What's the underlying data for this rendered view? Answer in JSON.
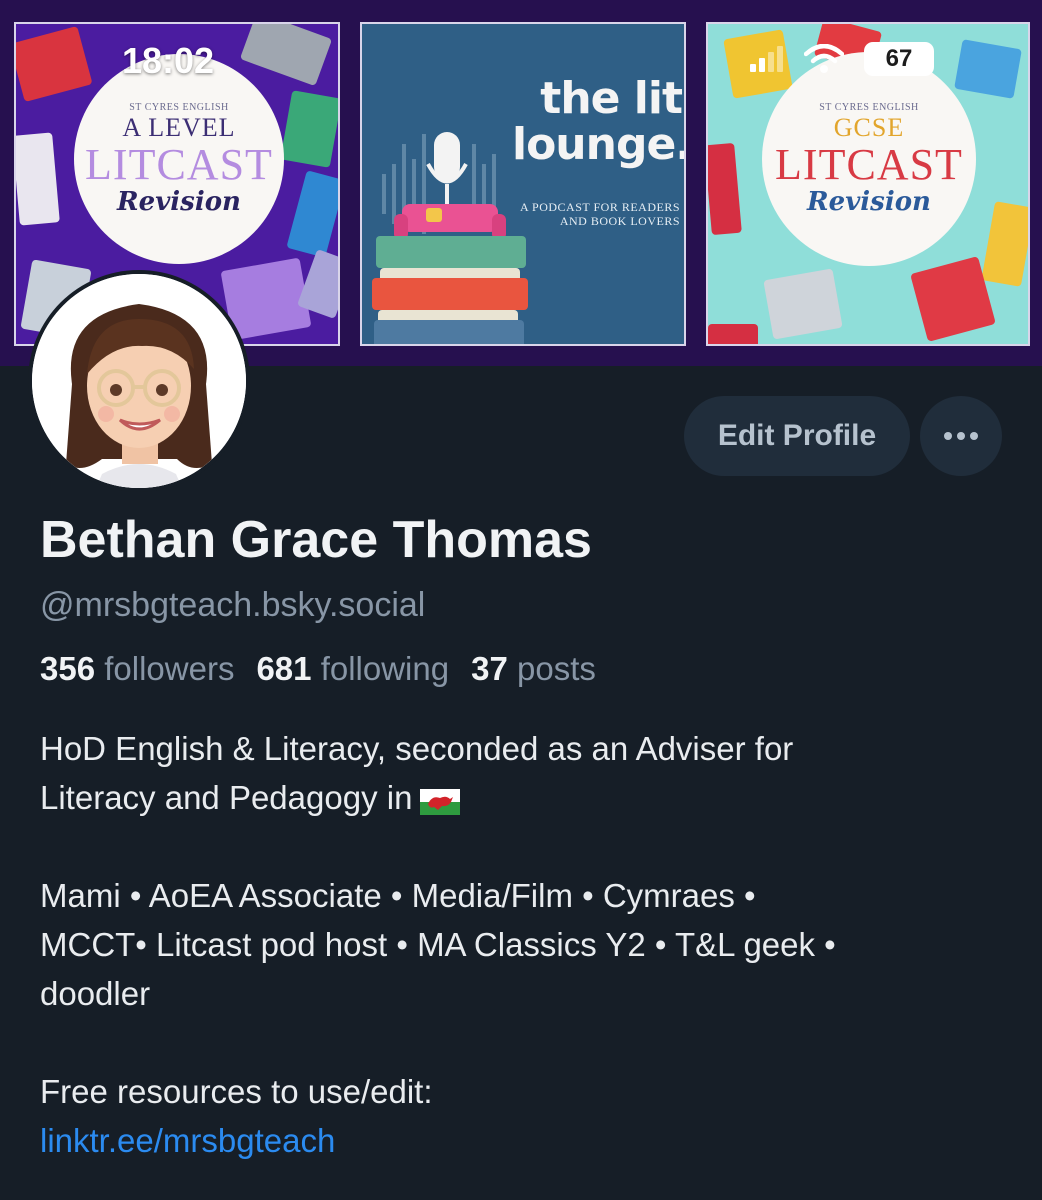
{
  "status_bar": {
    "time": "18:02",
    "battery": "67"
  },
  "banner": {
    "tile1": {
      "small": "ST CYRES ENGLISH",
      "level": "A LEVEL",
      "big": "LITCAST",
      "rev": "Revision"
    },
    "tile2": {
      "title_line1": "the lit",
      "title_line2": "lounge.",
      "sub_line1": "A PODCAST FOR READERS",
      "sub_line2": "AND BOOK LOVERS"
    },
    "tile3": {
      "small": "ST CYRES ENGLISH",
      "level": "GCSE",
      "big": "LITCAST",
      "rev": "Revision"
    }
  },
  "profile": {
    "name": "Bethan Grace Thomas",
    "handle": "@mrsbgteach.bsky.social",
    "edit_label": "Edit Profile",
    "more_icon": "ellipsis-icon",
    "stats": {
      "followers_count": "356",
      "followers_label": "followers",
      "following_count": "681",
      "following_label": "following",
      "posts_count": "37",
      "posts_label": "posts"
    },
    "bio": {
      "line1": "HoD English & Literacy, seconded as an Adviser for",
      "line2": "Literacy and Pedagogy in",
      "line3": "Mami • AoEA Associate  • Media/Film • Cymraes •",
      "line4": "MCCT• Litcast pod host • MA Classics Y2 • T&L geek •",
      "line5": "doodler",
      "line6": "Free resources to use/edit:",
      "link": "linktr.ee/mrsbgteach"
    }
  },
  "colors": {
    "background": "#161e27",
    "link": "#2b8bf0",
    "muted": "#8896a6",
    "button_bg": "#202d3b"
  }
}
